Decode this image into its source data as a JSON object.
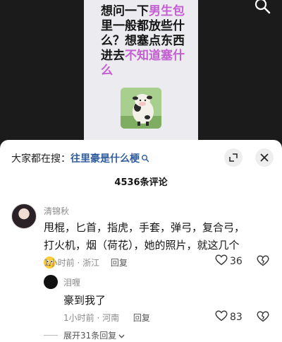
{
  "video": {
    "caption_parts": [
      {
        "text": "想问一下",
        "highlight": false
      },
      {
        "text": "男生包",
        "highlight": true
      },
      {
        "text": "里一般都放些什么？想塞点东西进去",
        "highlight": false
      },
      {
        "text": "不知道塞什么",
        "highlight": true
      }
    ],
    "highlight_color": "#c35fd0"
  },
  "sheet": {
    "trend_prefix": "大家都在搜：",
    "trend_link": "往里豪是什么梗",
    "comment_count": "4536条评论"
  },
  "comment": {
    "username": "清锦秋",
    "text": "甩棍，匕首，指虎，手套，弹弓，复合弓，打火机，烟（荷花），她的照片，就这几个",
    "time": "1小时前 · 浙江",
    "reply_label": "回复",
    "likes": "36"
  },
  "reply": {
    "username": "泪喱",
    "text": "豪到我了",
    "time": "1小时前 · 河南",
    "reply_label": "回复",
    "likes": "83"
  },
  "expand_label": "展开31条回复",
  "icons": {
    "search": "search-icon",
    "expand": "fullscreen-icon",
    "close": "close-icon",
    "like": "heart-icon",
    "dislike": "broken-heart-icon"
  }
}
